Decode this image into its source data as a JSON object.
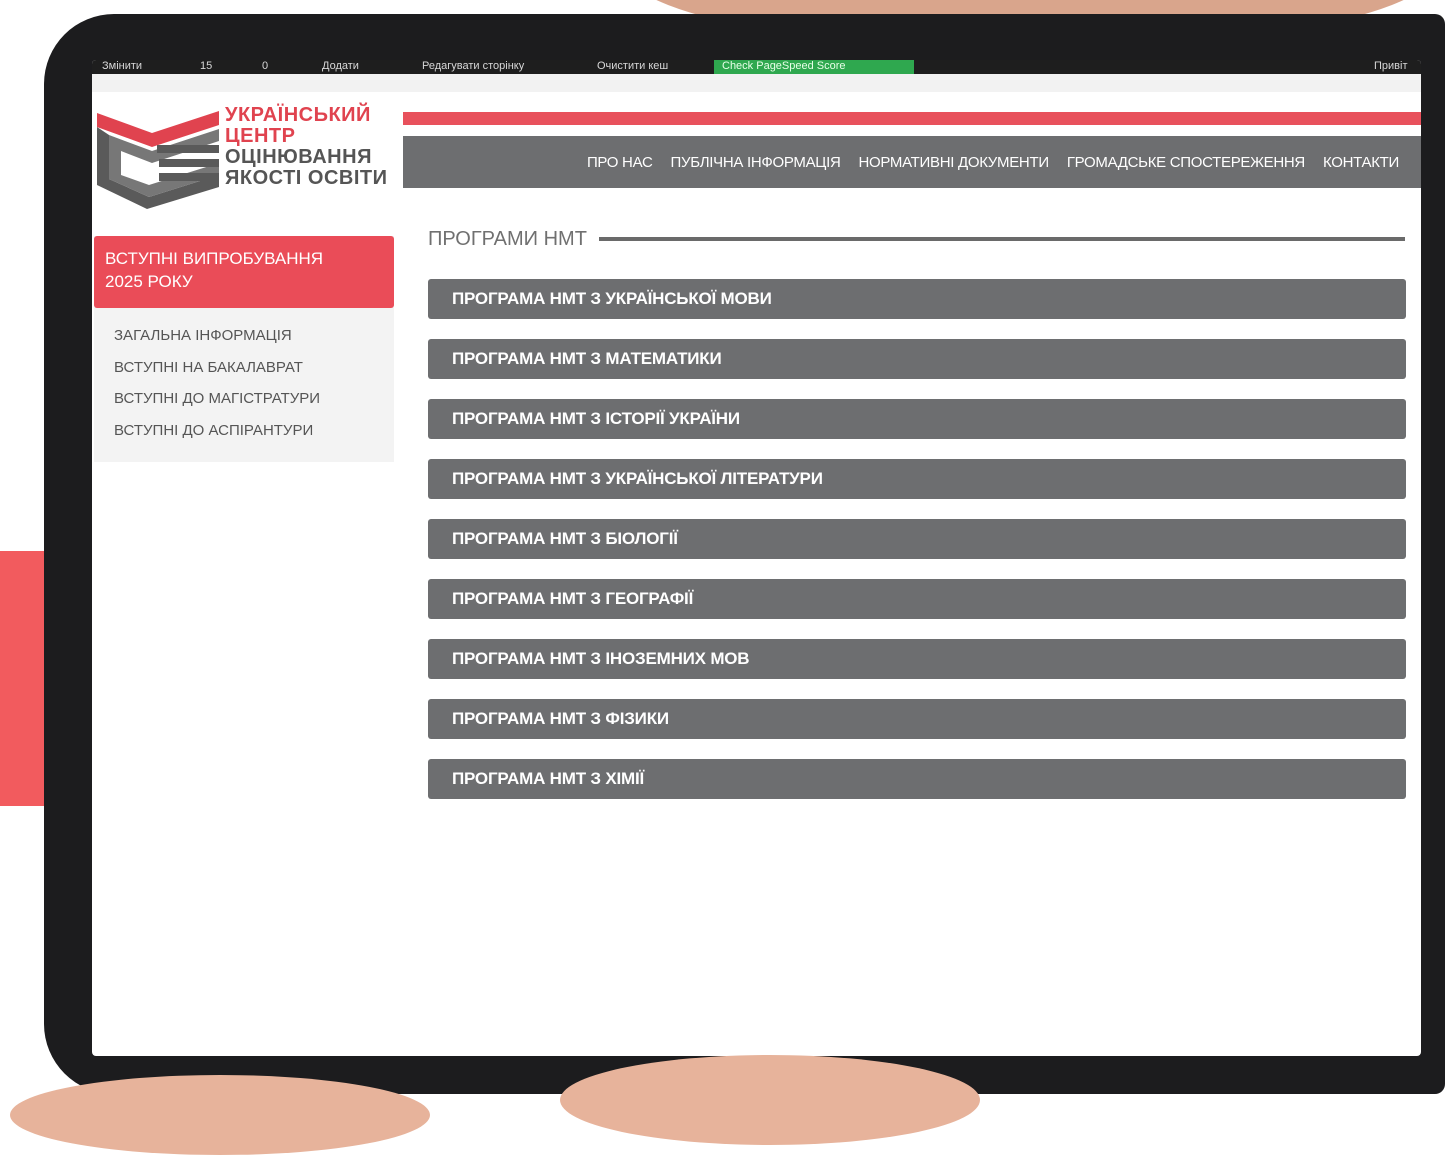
{
  "admin_bar": {
    "items": [
      "Змінити",
      "15",
      "0",
      "Додати",
      "Редагувати сторінку",
      "Очистити кеш"
    ],
    "pagespeed": "Check PageSpeed Score",
    "right": "Привіт"
  },
  "logo": {
    "line1": "УКРАЇНСЬКИЙ",
    "line2": "ЦЕНТР",
    "line3": "ОЦІНЮВАННЯ",
    "line4": "ЯКОСТІ ОСВІТИ"
  },
  "nav": {
    "items": [
      "ПРО НАС",
      "ПУБЛІЧНА ІНФОРМАЦІЯ",
      "НОРМАТИВНІ ДОКУМЕНТИ",
      "ГРОМАДСЬКЕ СПОСТЕРЕЖЕННЯ",
      "КОНТАКТИ"
    ]
  },
  "sidebar": {
    "header_line1": "ВСТУПНІ ВИПРОБУВАННЯ",
    "header_line2": "2025 РОКУ",
    "items": [
      "ЗАГАЛЬНА ІНФОРМАЦІЯ",
      "ВСТУПНІ НА БАКАЛАВРАТ",
      "ВСТУПНІ ДО МАГІСТРАТУРИ",
      "ВСТУПНІ ДО АСПІРАНТУРИ"
    ]
  },
  "main": {
    "section_title": "ПРОГРАМИ НМТ",
    "programs": [
      "ПРОГРАМА НМТ З УКРАЇНСЬКОЇ МОВИ",
      "ПРОГРАМА НМТ З МАТЕМАТИКИ",
      "ПРОГРАМА НМТ З ІСТОРІЇ УКРАЇНИ",
      "ПРОГРАМА НМТ З УКРАЇНСЬКОЇ ЛІТЕРАТУРИ",
      "ПРОГРАМА НМТ З БІОЛОГІЇ",
      "ПРОГРАМА НМТ З ГЕОГРАФІЇ",
      "ПРОГРАМА НМТ З ІНОЗЕМНИХ МОВ",
      "ПРОГРАМА НМТ З ФІЗИКИ",
      "ПРОГРАМА НМТ З ХІМІЇ"
    ]
  },
  "colors": {
    "accent": "#e8515c",
    "nav_bg": "#6d6e70",
    "brand_grey": "#555555"
  }
}
